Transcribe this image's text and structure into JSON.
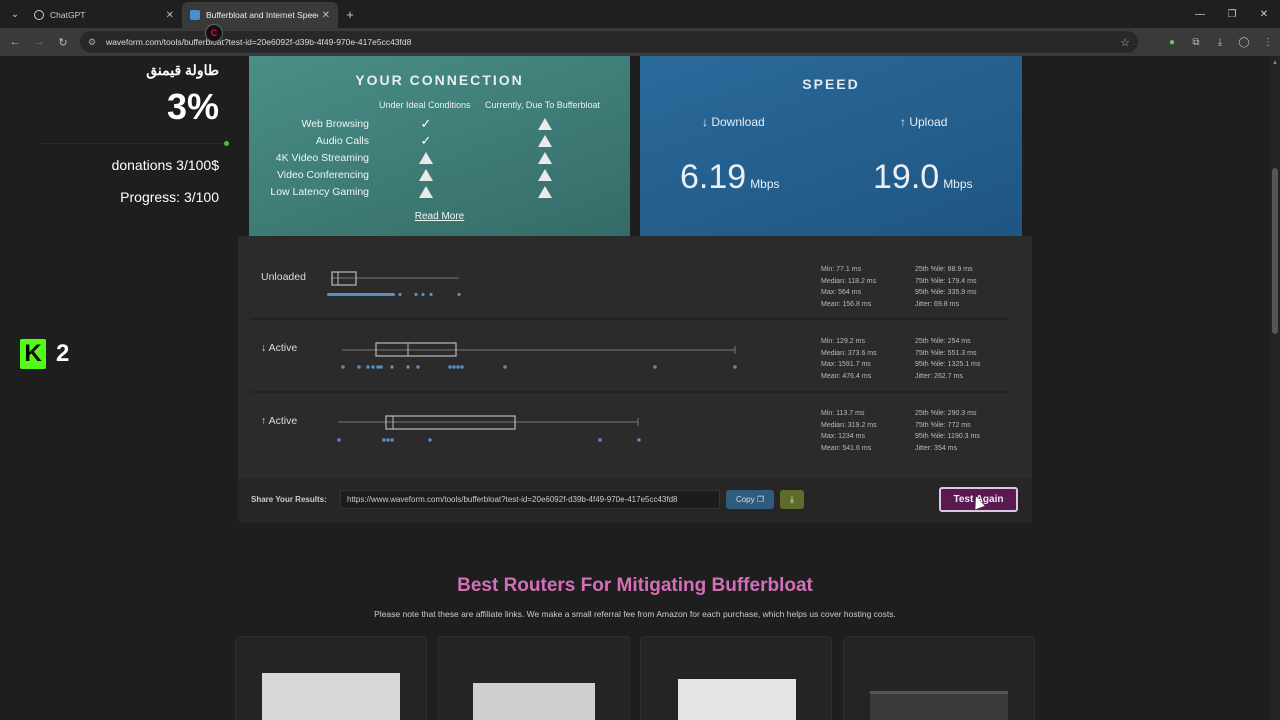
{
  "browser": {
    "tabs": [
      {
        "title": "ChatGPT",
        "active": false,
        "favicon_color": "#cccccc"
      },
      {
        "title": "Bufferbloat and Internet Speed",
        "active": true,
        "favicon_color": "#4a8fd0"
      }
    ],
    "url": "waveform.com/tools/bufferbloat?test-id=20e6092f-d39b-4f49-970e-417e5cc43fd8"
  },
  "overlay": {
    "title": "طاولة قيمنق",
    "percent": "3%",
    "donations": "donations 3/100$",
    "progress_text": "Progress: 3/100",
    "progress_fraction": 0.03,
    "kick_count": "2"
  },
  "connection": {
    "title": "YOUR CONNECTION",
    "col_ideal": "Under Ideal Conditions",
    "col_current": "Currently, Due To Bufferbloat",
    "rows": [
      {
        "label": "Web Browsing",
        "ideal": "check",
        "current": "warning"
      },
      {
        "label": "Audio Calls",
        "ideal": "check",
        "current": "warning"
      },
      {
        "label": "4K Video Streaming",
        "ideal": "warning",
        "current": "warning"
      },
      {
        "label": "Video Conferencing",
        "ideal": "warning",
        "current": "warning"
      },
      {
        "label": "Low Latency Gaming",
        "ideal": "warning",
        "current": "warning"
      }
    ],
    "read_more": "Read More"
  },
  "speed": {
    "title": "SPEED",
    "download_label": "↓ Download",
    "upload_label": "↑ Upload",
    "download_value": "6.19",
    "upload_value": "19.0",
    "unit": "Mbps"
  },
  "latency": {
    "unloaded": {
      "label": "Unloaded",
      "stats_left": [
        "Min: 77.1 ms",
        "Median: 118.2 ms",
        "Max: 564 ms",
        "Mean: 156.8 ms"
      ],
      "stats_right": [
        "25th %ile: 88.9 ms",
        "75th %ile: 179.4 ms",
        "95th %ile: 335.9 ms",
        "Jitter: 69.8 ms"
      ]
    },
    "down_active": {
      "label": "↓ Active",
      "stats_left": [
        "Min: 129.2 ms",
        "Median: 373.6 ms",
        "Max: 1591.7 ms",
        "Mean: 476.4 ms"
      ],
      "stats_right": [
        "25th %ile: 254 ms",
        "75th %ile: 551.3 ms",
        "95th %ile: 1325.1 ms",
        "Jitter: 262.7 ms"
      ]
    },
    "up_active": {
      "label": "↑ Active",
      "stats_left": [
        "Min: 113.7 ms",
        "Median: 319.2 ms",
        "Max: 1234 ms",
        "Mean: 541.6 ms"
      ],
      "stats_right": [
        "25th %ile: 290.3 ms",
        "75th %ile: 772 ms",
        "95th %ile: 1190.3 ms",
        "Jitter: 354 ms"
      ]
    }
  },
  "share": {
    "label": "Share Your Results:",
    "url": "https://www.waveform.com/tools/bufferbloat?test-id=20e6092f-d39b-4f49-970e-417e5cc43fd8",
    "copy_label": "Copy",
    "test_again_label": "Test Again"
  },
  "routers": {
    "title": "Best Routers For Mitigating Bufferbloat",
    "note": "Please note that these are affiliate links. We make a small referral fee from Amazon for each purchase, which helps us cover hosting costs."
  },
  "colors": {
    "connection_card": "#4a8f87",
    "speed_card": "#2a6a9b",
    "accent_pink": "#d36fb7",
    "test_again_bg": "#5b1a4f"
  }
}
